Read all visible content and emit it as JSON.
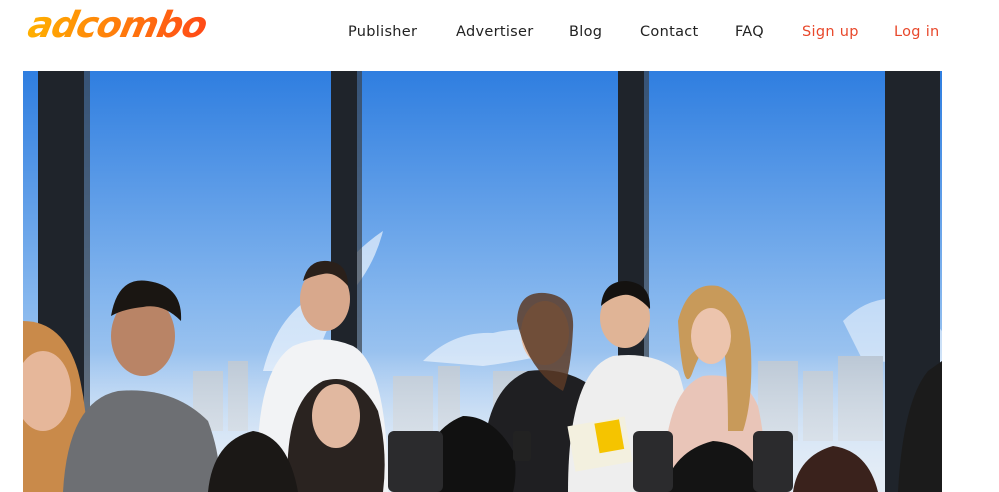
{
  "brand": {
    "name": "adcombo",
    "colors": {
      "logo_start": "#ff9d00",
      "logo_end": "#ff5b17",
      "accent": "#e8482b"
    }
  },
  "nav": {
    "items": [
      {
        "label": "Publisher",
        "accent": false
      },
      {
        "label": "Advertiser",
        "accent": false
      },
      {
        "label": "Blog",
        "accent": false
      },
      {
        "label": "Contact",
        "accent": false
      },
      {
        "label": "FAQ",
        "accent": false
      },
      {
        "label": "Sign up",
        "accent": true
      },
      {
        "label": "Log in",
        "accent": true
      }
    ]
  },
  "hero": {
    "image": "team-photo-office-window-city-skyline"
  }
}
